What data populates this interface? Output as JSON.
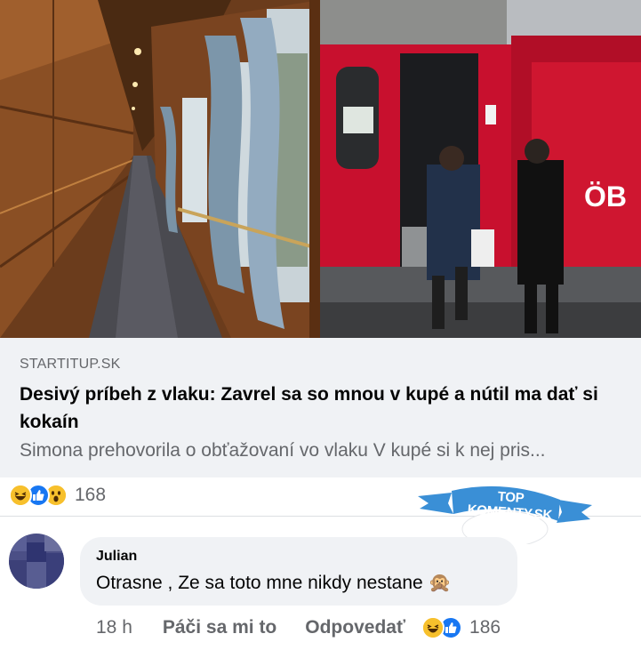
{
  "link_preview": {
    "domain": "STARTITUP.SK",
    "headline": "Desivý príbeh z vlaku: Zavrel sa so mnou v kupé a nútil ma dať si kokaín",
    "description": "Simona prehovorila o obťažovaní vo vlaku V kupé si k nej pris...",
    "image_left": "train-corridor-photo",
    "image_right": "train-boarding-photo",
    "train_logo": "ÖB"
  },
  "post_reactions": {
    "icons": [
      "haha-icon",
      "like-icon",
      "wow-icon"
    ],
    "count": "168"
  },
  "watermark": {
    "text": "TOP KOMENTY.SK",
    "color": "#3a8fd6"
  },
  "comment": {
    "author": "Julian",
    "text": "Otrasne , Ze sa toto mne nikdy nestane 🙊",
    "time": "18 h",
    "like_label": "Páči sa mi to",
    "reply_label": "Odpovedať",
    "reaction_icons": [
      "haha-icon",
      "like-icon"
    ],
    "reaction_count": "186"
  },
  "colors": {
    "secondary_text": "#65676b",
    "bubble_bg": "#f0f2f5",
    "like_blue": "#1877f2",
    "train_red": "#c8102e"
  }
}
